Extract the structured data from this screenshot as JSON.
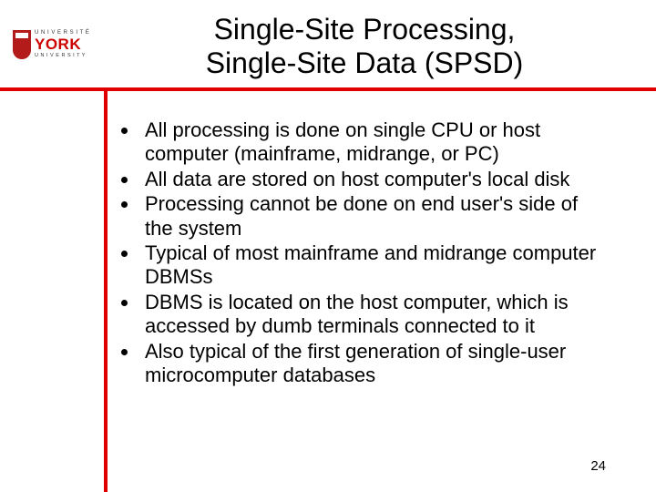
{
  "logo": {
    "top": "U N I V E R S I T É",
    "main": "YORK",
    "bottom": "U N I V E R S I T Y"
  },
  "title": {
    "line1": "Single-Site Processing,",
    "line2": "Single-Site Data (SPSD)"
  },
  "bullets": [
    "All processing is done on single CPU or host computer (mainframe, midrange, or PC)",
    "All data are stored on host computer's local disk",
    "Processing cannot be done on end user's side of the system",
    "Typical of most mainframe and midrange computer DBMSs",
    "DBMS is located on the host computer, which is accessed by dumb terminals connected to it",
    "Also typical of the first generation of single-user microcomputer databases"
  ],
  "page_number": "24"
}
